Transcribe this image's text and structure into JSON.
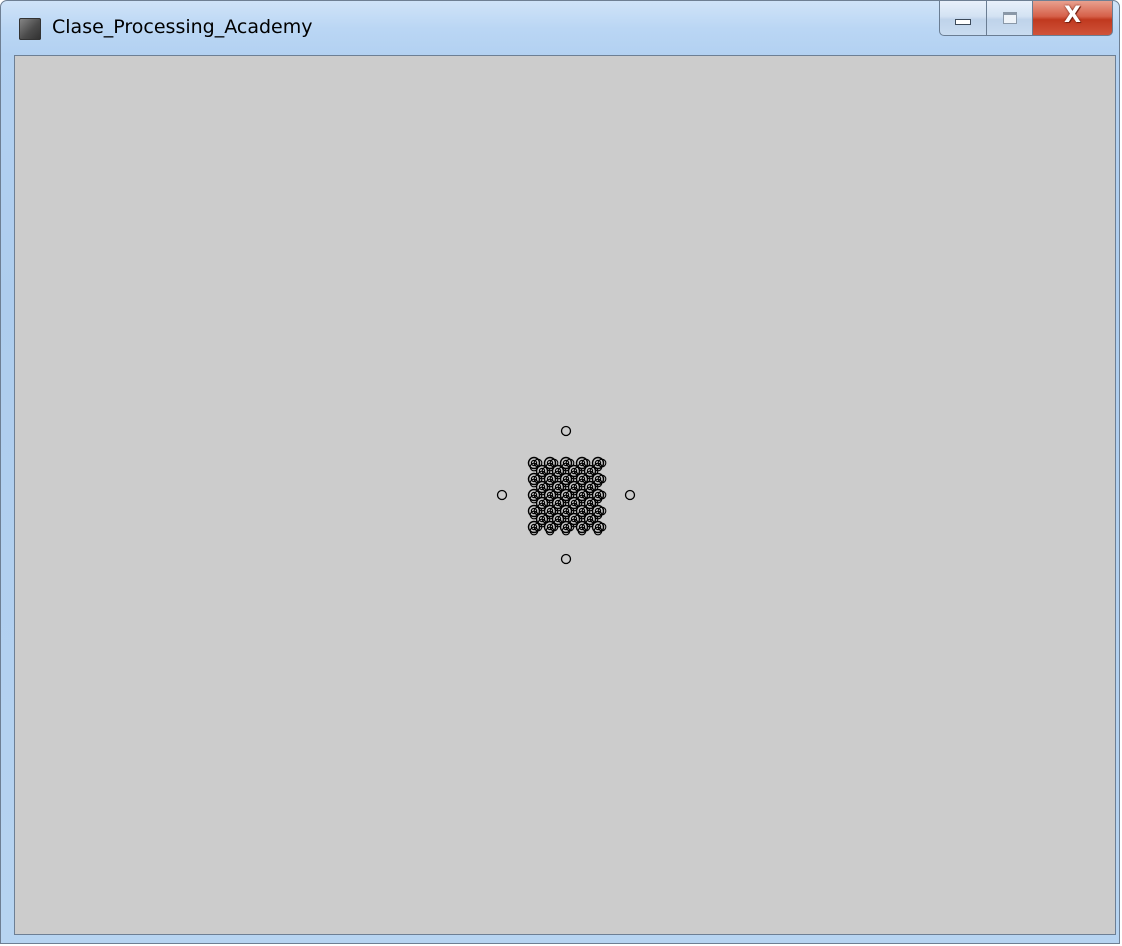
{
  "window": {
    "title": "Clase_Processing_Academy",
    "controls": {
      "minimize_glyph": "",
      "maximize_glyph": "",
      "close_glyph": "X"
    },
    "icons": {
      "app": "processing-app-icon",
      "minimize": "minimize-icon",
      "maximize": "maximize-icon",
      "close": "close-icon"
    }
  },
  "sketch": {
    "background_color": "#cccccc",
    "stroke_color": "#000000",
    "shape": "diamond-of-circles",
    "rows": 9
  }
}
